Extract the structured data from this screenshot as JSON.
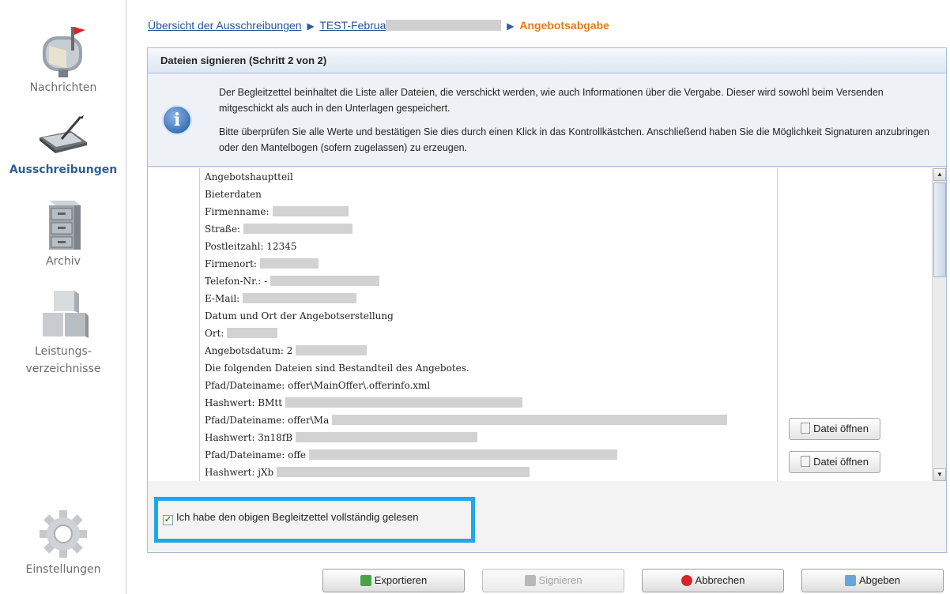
{
  "sidebar": {
    "items": [
      {
        "label": "Nachrichten",
        "icon": "mailbox-icon"
      },
      {
        "label": "Ausschreibungen",
        "icon": "tablet-pen-icon",
        "active": true
      },
      {
        "label": "Archiv",
        "icon": "filing-cabinet-icon"
      },
      {
        "label": "Leistungs-",
        "label2": "verzeichnisse",
        "icon": "cubes-icon"
      },
      {
        "label": "Einstellungen",
        "icon": "gear-icon"
      }
    ]
  },
  "breadcrumb": {
    "link1": "Übersicht der Ausschreibungen",
    "link2": "TEST-Februa",
    "current": "Angebotsabgabe"
  },
  "panel": {
    "title": "Dateien signieren (Schritt 2 von 2)",
    "info_p1": "Der Begleitzettel beinhaltet die Liste aller Dateien, die verschickt werden, wie auch Informationen über die Vergabe. Dieser wird sowohl beim Versenden mitgeschickt als auch in den Unterlagen gespeichert.",
    "info_p2": "Bitte überprüfen Sie alle Werte und bestätigen Sie dies durch einen Klick in das Kontrollkästchen. Anschließend haben Sie die Möglichkeit Signaturen anzubringen oder den Mantelbogen (sofern zugelassen) zu erzeugen."
  },
  "document": {
    "lines": [
      "Angebotshauptteil",
      "Bieterdaten",
      "Firmenname:",
      "Straße:",
      "Postleitzahl: 12345",
      "Firmenort:",
      "Telefon-Nr.: -",
      "E-Mail:",
      "Datum und Ort der Angebotserstellung",
      "Ort:",
      "Angebotsdatum: 2",
      "Die folgenden Dateien sind Bestandteil des Angebotes.",
      "Pfad/Dateiname: offer\\MainOffer\\.offerinfo.xml",
      "Hashwert: BMtt",
      "Pfad/Dateiname: offer\\Ma",
      "Hashwert: 3n18fB",
      "Pfad/Dateiname: offe",
      "Hashwert: jXb"
    ],
    "open_button_label": "Datei öffnen"
  },
  "confirm": {
    "label": "Ich habe den obigen Begleitzettel vollständig gelesen",
    "checked": true
  },
  "buttons": {
    "export": "Exportieren",
    "sign": "Signieren",
    "cancel": "Abbrechen",
    "submit": "Abgeben"
  },
  "colors": {
    "accent": "#2f5d99",
    "current_crumb": "#e07b1a",
    "highlight_border": "#1ea8e8"
  }
}
